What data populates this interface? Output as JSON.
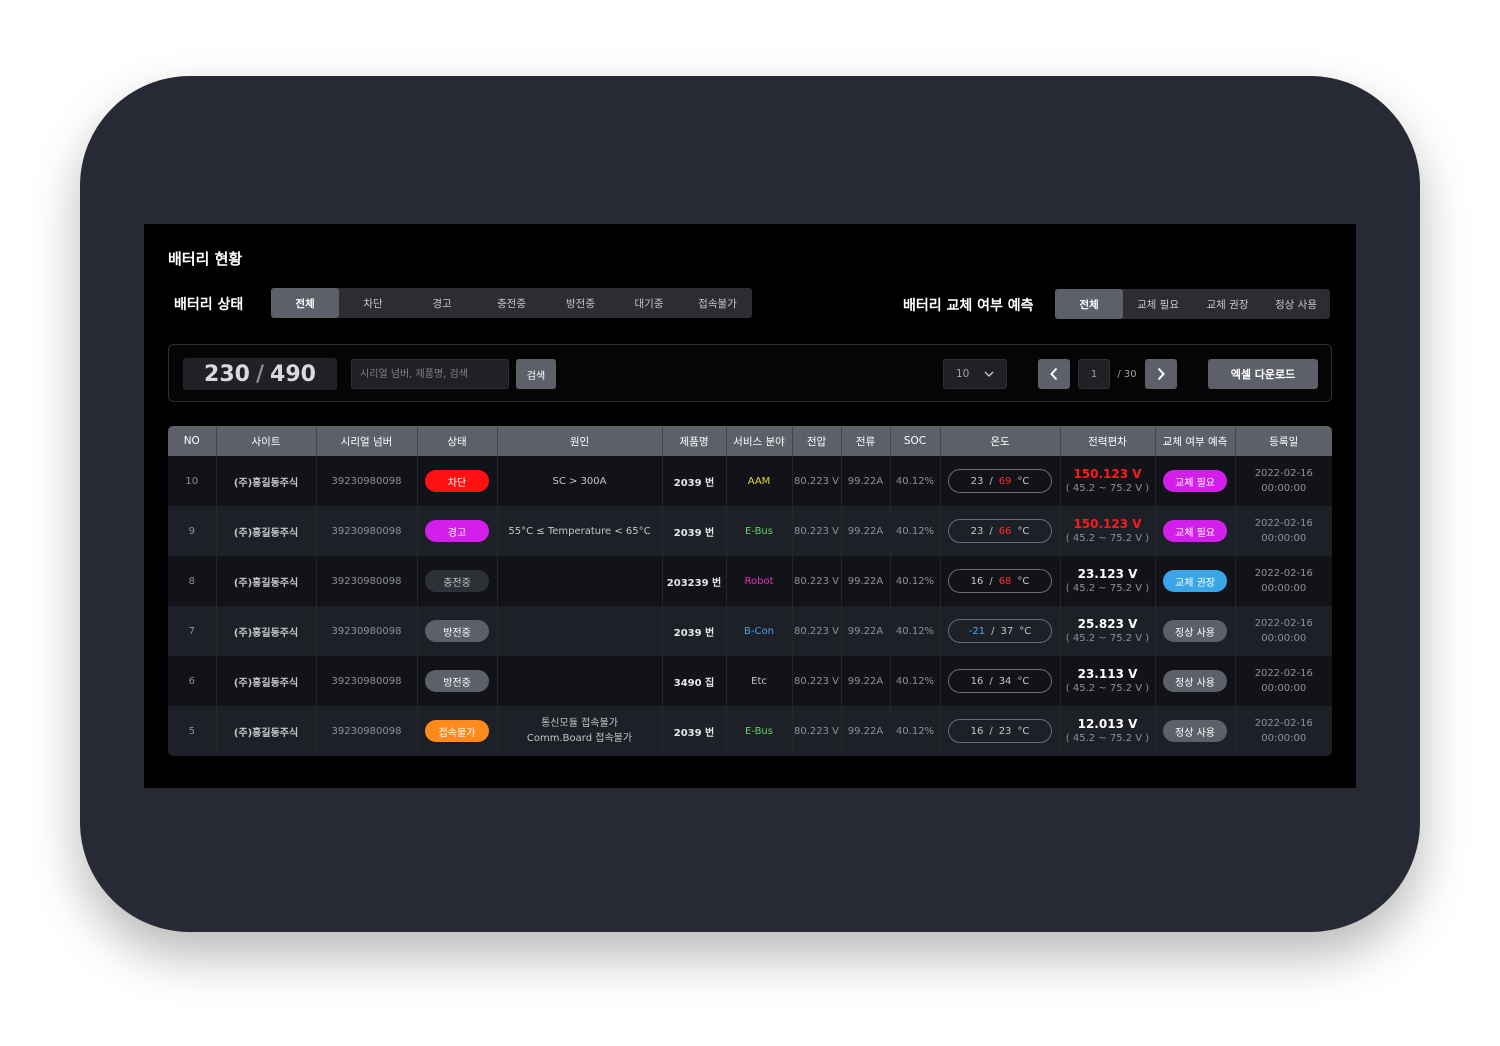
{
  "page_title": "배터리 현황",
  "status_filter": {
    "label": "배터리 상태",
    "options": [
      "전체",
      "차단",
      "경고",
      "충전중",
      "방전중",
      "대기중",
      "접속불가"
    ],
    "active_index": 0
  },
  "replace_filter": {
    "label": "배터리 교체 여부 예측",
    "options": [
      "전체",
      "교체 필요",
      "교체 권장",
      "정상 사용"
    ],
    "active_index": 0
  },
  "toolbar": {
    "count_current": "230",
    "count_separator": "/",
    "count_total": "490",
    "search_placeholder": "시리얼 넘버, 제품명, 검색",
    "search_value": "",
    "search_label": "검색",
    "page_size": "10",
    "current_page": "1",
    "total_pages": "/ 30",
    "excel_label": "엑셀 다운로드"
  },
  "table": {
    "headers": [
      "NO",
      "사이트",
      "시리얼 넘버",
      "상태",
      "원인",
      "제품명",
      "서비스 분야",
      "전압",
      "전류",
      "SOC",
      "온도",
      "전력편차",
      "교체 여부 예측",
      "등록일"
    ],
    "rows": [
      {
        "no": "10",
        "site": "(주)홍길동주식",
        "serial": "39230980098",
        "status": "차단",
        "status_color": "#ff1111",
        "cause": "SC > 300A",
        "cause2": "",
        "product": "2039 번",
        "service": "AAM",
        "service_color": "#e3d33a",
        "voltage": "80.223 V",
        "current": "99.22A",
        "soc": "40.12%",
        "temp_min": "23",
        "temp_min_color": "#c4c6cc",
        "temp_sep": "/",
        "temp_max": "69",
        "temp_max_color": "#ff2a2a",
        "temp_unit": "°C",
        "deviation": "150.123 V",
        "deviation_color": "#ff1a1a",
        "deviation_range": "( 45.2 ~ 75.2 V )",
        "replace": "교체 필요",
        "replace_color": "#d21fec",
        "date": "2022-02-16",
        "time": "00:00:00"
      },
      {
        "no": "9",
        "site": "(주)홍길동주식",
        "serial": "39230980098",
        "status": "경고",
        "status_color": "#d21fec",
        "cause": "55°C ≤ Temperature < 65°C",
        "cause2": "",
        "product": "2039 번",
        "service": "E-Bus",
        "service_color": "#5fd16a",
        "voltage": "80.223 V",
        "current": "99.22A",
        "soc": "40.12%",
        "temp_min": "23",
        "temp_min_color": "#c4c6cc",
        "temp_sep": "/",
        "temp_max": "66",
        "temp_max_color": "#ff2a2a",
        "temp_unit": "°C",
        "deviation": "150.123 V",
        "deviation_color": "#ff1a1a",
        "deviation_range": "( 45.2 ~ 75.2 V )",
        "replace": "교체 필요",
        "replace_color": "#d21fec",
        "date": "2022-02-16",
        "time": "00:00:00"
      },
      {
        "no": "8",
        "site": "(주)홍길동주식",
        "serial": "39230980098",
        "status": "충전중",
        "status_color": "#2e3037",
        "cause": "",
        "cause2": "",
        "product": "203239 번",
        "service": "Robot",
        "service_color": "#e030b8",
        "voltage": "80.223 V",
        "current": "99.22A",
        "soc": "40.12%",
        "temp_min": "16",
        "temp_min_color": "#c4c6cc",
        "temp_sep": "/",
        "temp_max": "68",
        "temp_max_color": "#ff2a2a",
        "temp_unit": "°C",
        "deviation": "23.123 V",
        "deviation_color": "#ffffff",
        "deviation_range": "( 45.2 ~ 75.2 V )",
        "replace": "교체 권장",
        "replace_color": "#3aa6e8",
        "date": "2022-02-16",
        "time": "00:00:00"
      },
      {
        "no": "7",
        "site": "(주)홍길동주식",
        "serial": "39230980098",
        "status": "방전중",
        "status_color": "#5d6069",
        "cause": "",
        "cause2": "",
        "product": "2039 번",
        "service": "B-Con",
        "service_color": "#4a9ee6",
        "voltage": "80.223 V",
        "current": "99.22A",
        "soc": "40.12%",
        "temp_min": "-21",
        "temp_min_color": "#4aa8ef",
        "temp_sep": "/",
        "temp_max": "37",
        "temp_max_color": "#c4c6cc",
        "temp_unit": "°C",
        "deviation": "25.823 V",
        "deviation_color": "#ffffff",
        "deviation_range": "( 45.2 ~ 75.2 V )",
        "replace": "정상 사용",
        "replace_color": "#5d6069",
        "date": "2022-02-16",
        "time": "00:00:00"
      },
      {
        "no": "6",
        "site": "(주)홍길동주식",
        "serial": "39230980098",
        "status": "방전중",
        "status_color": "#5d6069",
        "cause": "",
        "cause2": "",
        "product": "3490 집",
        "service": "Etc",
        "service_color": "#c4c6cc",
        "voltage": "80.223 V",
        "current": "99.22A",
        "soc": "40.12%",
        "temp_min": "16",
        "temp_min_color": "#c4c6cc",
        "temp_sep": "/",
        "temp_max": "34",
        "temp_max_color": "#c4c6cc",
        "temp_unit": "°C",
        "deviation": "23.113 V",
        "deviation_color": "#ffffff",
        "deviation_range": "( 45.2 ~ 75.2 V )",
        "replace": "정상 사용",
        "replace_color": "#5d6069",
        "date": "2022-02-16",
        "time": "00:00:00"
      },
      {
        "no": "5",
        "site": "(주)홍길동주식",
        "serial": "39230980098",
        "status": "접속불가",
        "status_color": "#ff8a1c",
        "cause": "통신모듈 접속불가",
        "cause2": "Comm.Board 접속불가",
        "product": "2039 번",
        "service": "E-Bus",
        "service_color": "#5fd16a",
        "voltage": "80.223 V",
        "current": "99.22A",
        "soc": "40.12%",
        "temp_min": "16",
        "temp_min_color": "#c4c6cc",
        "temp_sep": "/",
        "temp_max": "23",
        "temp_max_color": "#c4c6cc",
        "temp_unit": "°C",
        "deviation": "12.013 V",
        "deviation_color": "#ffffff",
        "deviation_range": "( 45.2 ~ 75.2 V )",
        "replace": "정상 사용",
        "replace_color": "#5d6069",
        "date": "2022-02-16",
        "time": "00:00:00"
      }
    ]
  }
}
